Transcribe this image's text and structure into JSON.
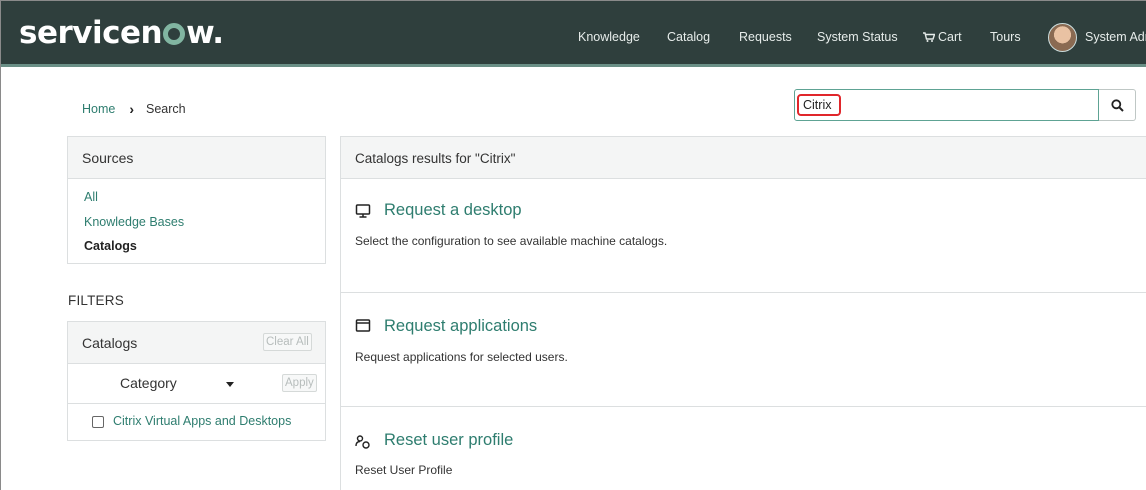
{
  "header": {
    "logo": {
      "prefix": "servicen",
      "suffix": "w."
    },
    "nav": [
      {
        "label": "Knowledge"
      },
      {
        "label": "Catalog"
      },
      {
        "label": "Requests"
      },
      {
        "label": "System Status"
      },
      {
        "label": "Cart"
      },
      {
        "label": "Tours"
      }
    ],
    "user_name": "System Adr",
    "accent": "#81b5a1",
    "background": "#2f3f3d"
  },
  "breadcrumb": {
    "home": "Home",
    "current": "Search"
  },
  "search": {
    "value": "Citrix",
    "button_icon": "search-icon"
  },
  "sources": {
    "title": "Sources",
    "items": [
      {
        "label": "All",
        "active": false
      },
      {
        "label": "Knowledge Bases",
        "active": false
      },
      {
        "label": "Catalogs",
        "active": true
      }
    ]
  },
  "filters": {
    "title": "FILTERS",
    "catalogs": {
      "title": "Catalogs",
      "clear_all": "Clear All",
      "category_label": "Category",
      "apply": "Apply",
      "options": [
        {
          "label": "Citrix Virtual Apps and Desktops",
          "checked": false
        }
      ]
    }
  },
  "results": {
    "heading": "Catalogs results for \"Citrix\"",
    "items": [
      {
        "icon": "desktop-icon",
        "title": "Request a desktop",
        "description": "Select the configuration to see available machine catalogs."
      },
      {
        "icon": "application-window-icon",
        "title": "Request applications",
        "description": "Request applications for selected users."
      },
      {
        "icon": "user-profile-icon",
        "title": "Reset user profile",
        "description": "Reset User Profile"
      }
    ]
  }
}
